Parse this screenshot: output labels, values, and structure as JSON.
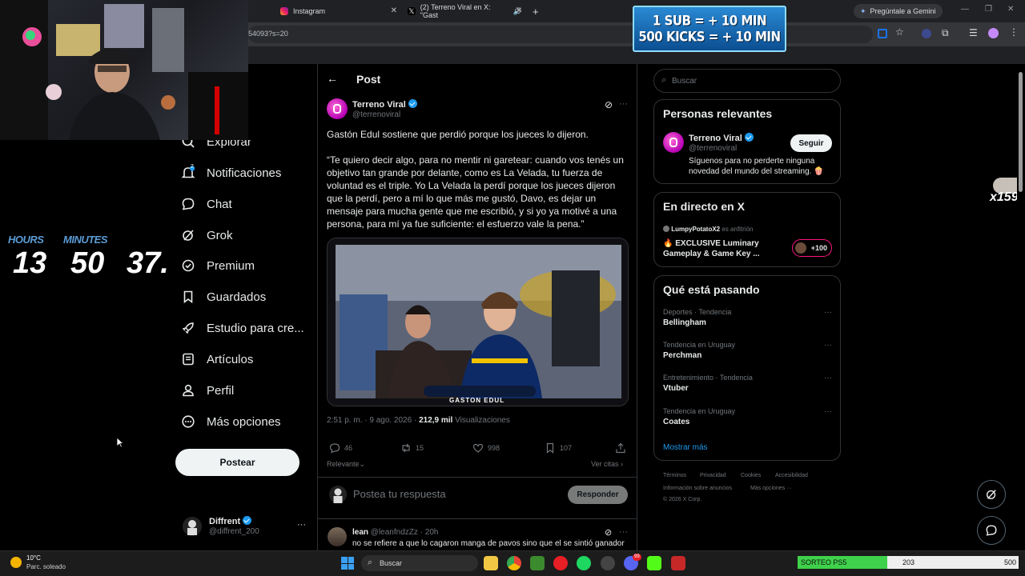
{
  "browser": {
    "tabs": [
      {
        "label": "Instagram"
      },
      {
        "label": "(2) Terreno Viral en X: \"Gast"
      }
    ],
    "url_fragment": "54093?s=20",
    "gemini_label": "Pregúntale a Gemini"
  },
  "promo": {
    "line1": "1 SUB = + 10 MIN",
    "line2": "500 KICKS = + 10 MIN"
  },
  "timer": {
    "hours_label": "HOURS",
    "minutes_label": "MINUTES",
    "hours": "13",
    "minutes": "50",
    "seconds": "37."
  },
  "nav": {
    "items": [
      {
        "label": "Explorar"
      },
      {
        "label": "Notificaciones",
        "badge": "2"
      },
      {
        "label": "Chat"
      },
      {
        "label": "Grok"
      },
      {
        "label": "Premium"
      },
      {
        "label": "Guardados"
      },
      {
        "label": "Estudio para cre..."
      },
      {
        "label": "Artículos"
      },
      {
        "label": "Perfil"
      },
      {
        "label": "Más opciones"
      }
    ],
    "post_button": "Postear",
    "account": {
      "name": "Diffrent",
      "handle": "@diffrent_200"
    }
  },
  "post": {
    "header": "Post",
    "author": {
      "name": "Terreno Viral",
      "handle": "@terrenoviral"
    },
    "text1": "Gastón Edul sostiene que perdió porque los jueces lo dijeron.",
    "text2": "“Te quiero decir algo, para no mentir ni garetear: cuando vos tenés un objetivo tan grande por delante, como es La Velada, tu fuerza de voluntad es el triple. Yo La Velada la perdí porque los jueces dijeron que la perdí, pero a mí lo que más me gustó, Davo, es dejar un mensaje para mucha gente que me escribió, y si yo ya motivé a una persona, para mí ya fue suficiente: el esfuerzo vale la pena.”",
    "media_caption": "GASTON EDUL",
    "timestamp": "2:51 p. m. · 9 ago. 2026 · ",
    "views_count": "212,9 mil",
    "views_label": "Visualizaciones",
    "stats": {
      "replies": "46",
      "reposts": "15",
      "likes": "998",
      "bookmarks": "107"
    },
    "sort_label": "Relevante",
    "quotes_label": "Ver citas",
    "reply_placeholder": "Postea tu respuesta",
    "reply_button": "Responder"
  },
  "reply": {
    "name": "lean",
    "handle": "@leanfndzZz",
    "time": "· 20h",
    "text": "no se refiere a que lo cagaron manga de pavos sino que el se sintió ganador"
  },
  "sidebar": {
    "search_placeholder": "Buscar",
    "relevant": {
      "title": "Personas relevantes",
      "name": "Terreno Viral",
      "handle": "@terrenoviral",
      "follow": "Seguir",
      "bio": "Síguenos para no perderte ninguna novedad del mundo del streaming. 🍿"
    },
    "live": {
      "title": "En directo en X",
      "host": "LumpyPotatoX2",
      "host_role": "es anfitrión",
      "stream_title": "🔥 EXCLUSIVE Luminary Gameplay & Game Key ...",
      "listeners": "+100"
    },
    "trends": {
      "title": "Qué está pasando",
      "items": [
        {
          "category": "Deportes · Tendencia",
          "name": "Bellingham"
        },
        {
          "category": "Tendencia en Uruguay",
          "name": "Perchman"
        },
        {
          "category": "Entretenimiento · Tendencia",
          "name": "Vtuber"
        },
        {
          "category": "Tendencia en Uruguay",
          "name": "Coates"
        }
      ],
      "show_more": "Mostrar más"
    },
    "footer": {
      "links": [
        "Términos",
        "Privacidad",
        "Cookies",
        "Accesibilidad",
        "Información sobre anuncios",
        "Más opciones ···"
      ],
      "copyright": "© 2026 X Corp."
    }
  },
  "overlay": {
    "viewer_count": "x159"
  },
  "taskbar": {
    "weather_temp": "10°C",
    "weather_desc": "Parc. soleado",
    "search_label": "Buscar",
    "badge_count": "99",
    "sorteo": {
      "label": "SORTEO PS5",
      "value": "203",
      "max": "500",
      "progress": 0.406
    }
  },
  "colors": {
    "accent": "#1d9bf0",
    "background": "#000000",
    "border": "#2f3336",
    "muted": "#71767b",
    "progress": "#3fd14b"
  }
}
